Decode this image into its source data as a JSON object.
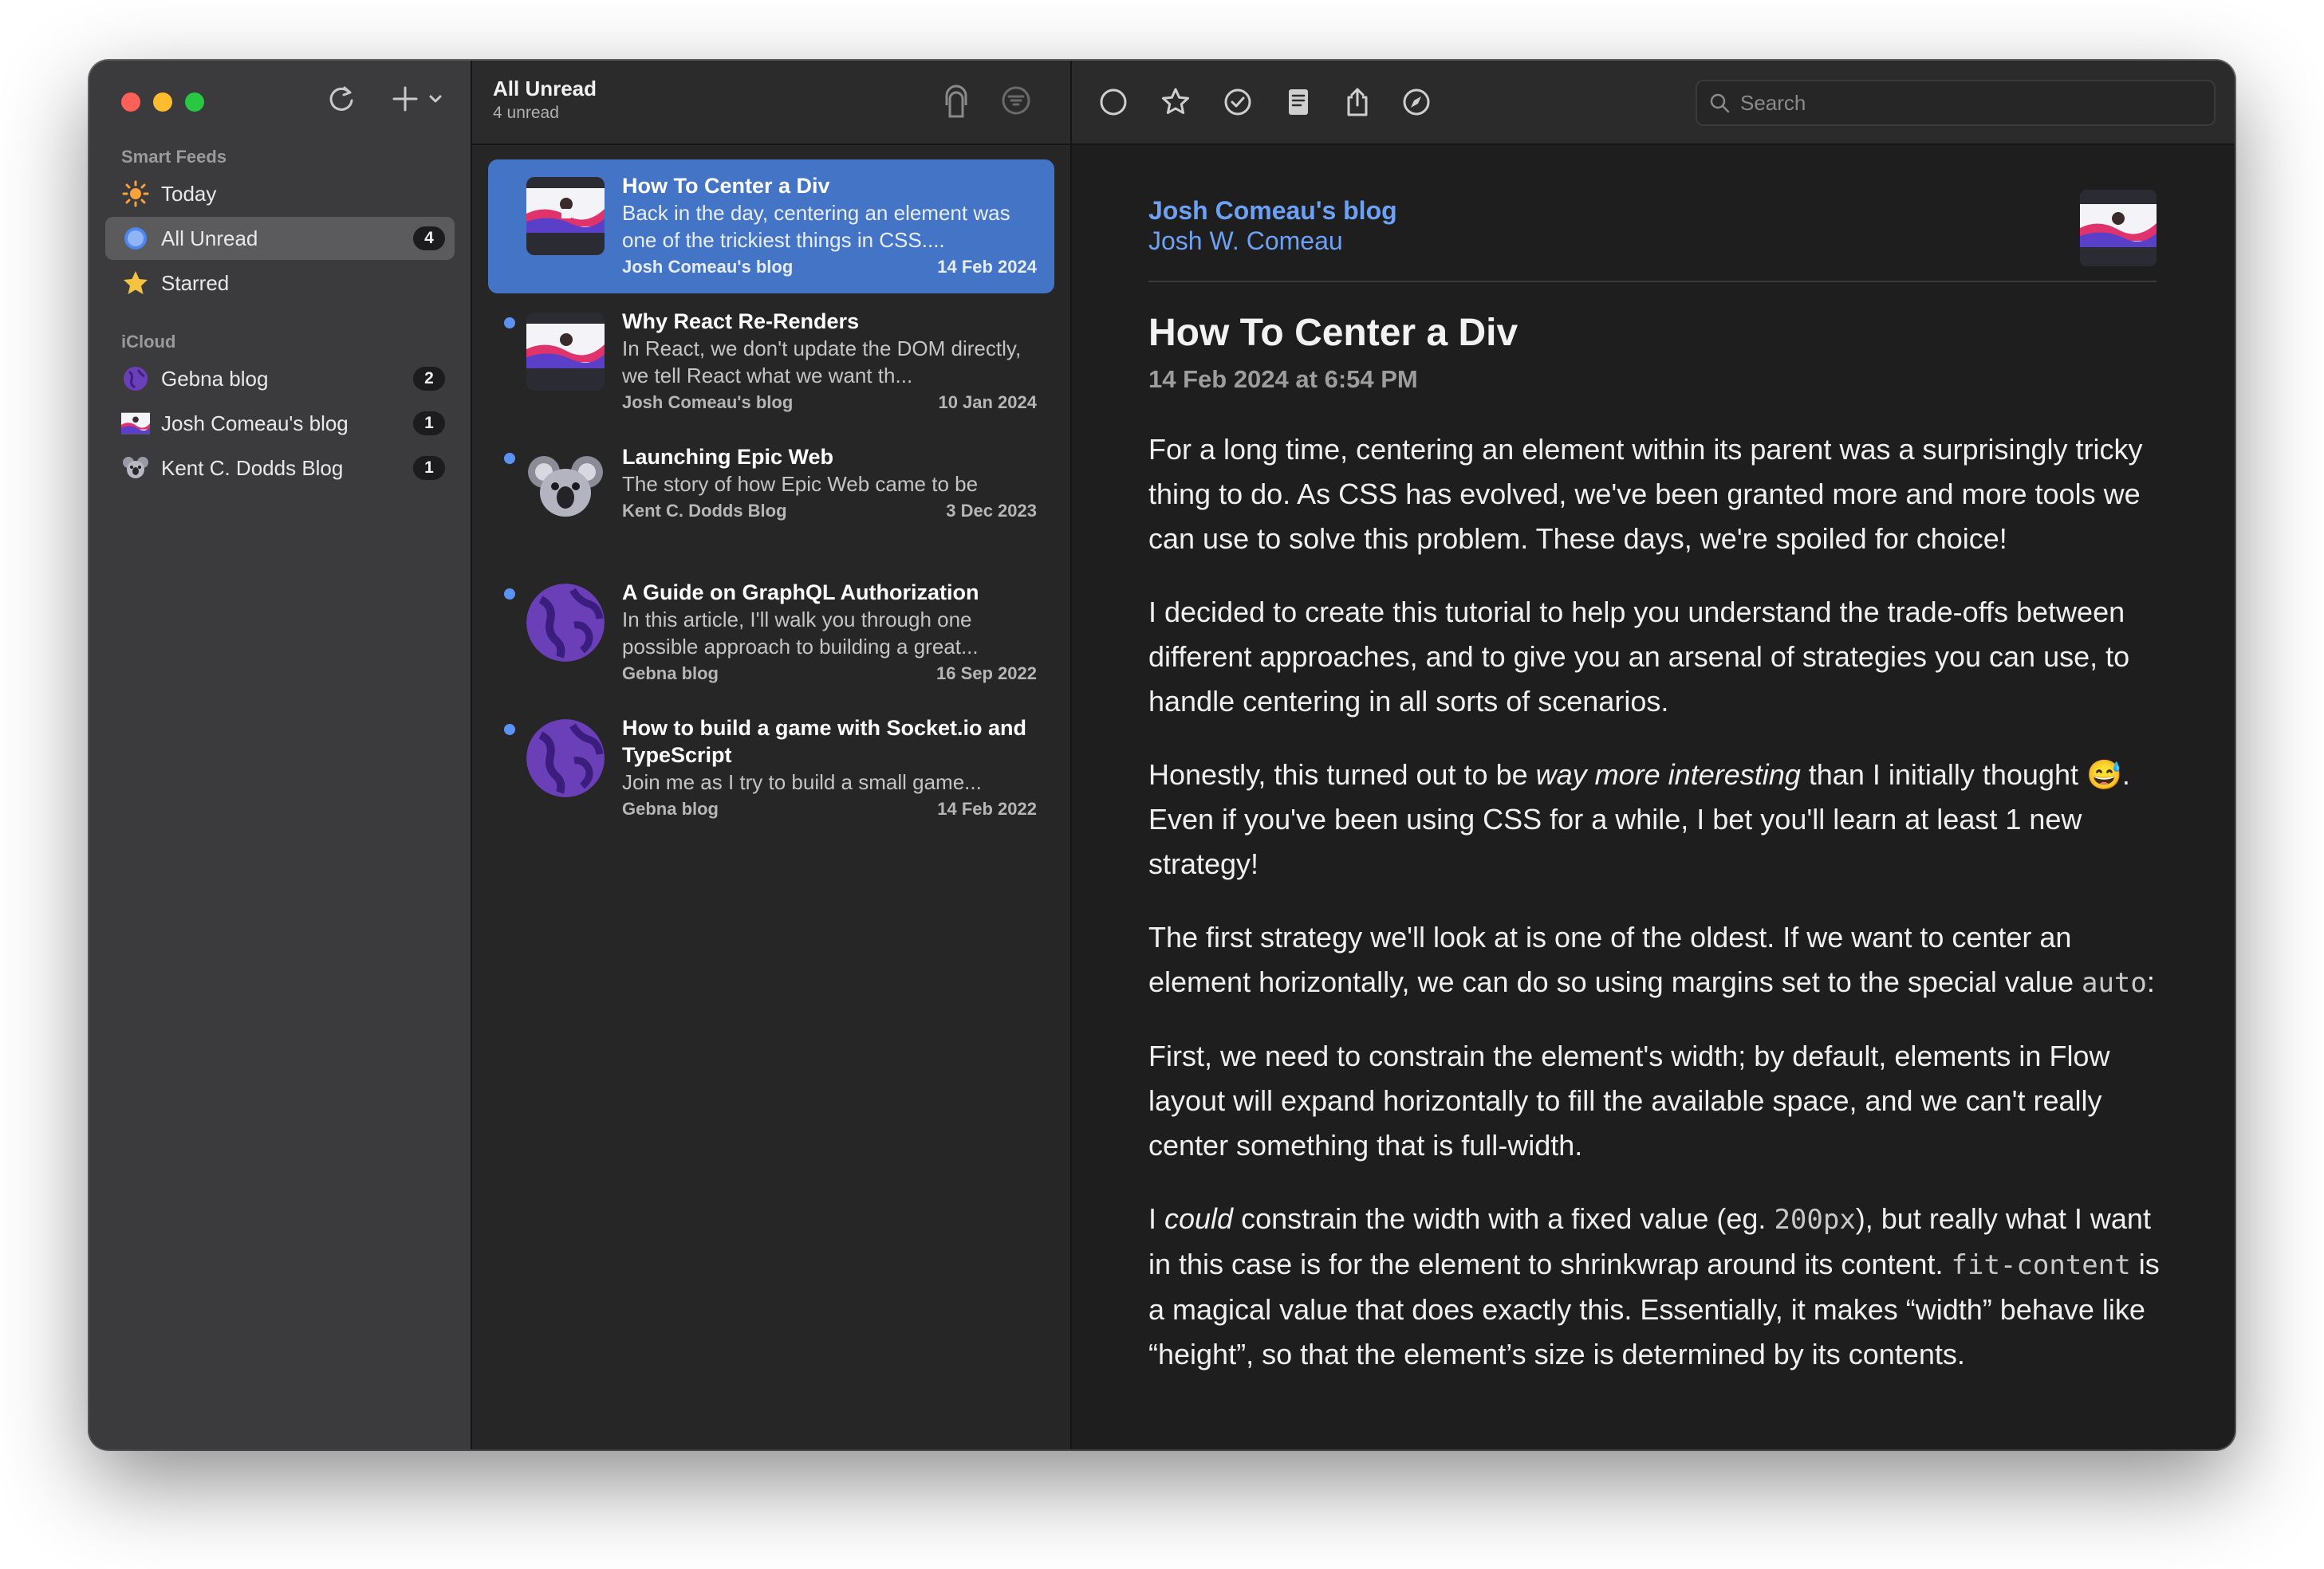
{
  "sidebar": {
    "smart_feeds_label": "Smart Feeds",
    "icloud_label": "iCloud",
    "smart_feeds": [
      {
        "label": "Today",
        "icon": "sun-icon",
        "badge": ""
      },
      {
        "label": "All Unread",
        "icon": "unread-circle-icon",
        "badge": "4"
      },
      {
        "label": "Starred",
        "icon": "star-icon",
        "badge": ""
      }
    ],
    "feeds": [
      {
        "label": "Gebna blog",
        "icon": "gebna-globe-favicon",
        "badge": "2"
      },
      {
        "label": "Josh Comeau's blog",
        "icon": "josh-comeau-favicon",
        "badge": "1"
      },
      {
        "label": "Kent C. Dodds Blog",
        "icon": "koala-favicon",
        "badge": "1"
      }
    ],
    "tools": {
      "refresh": "↻",
      "add": "+",
      "chevron": "⌄"
    }
  },
  "list": {
    "title": "All Unread",
    "subtitle": "4 unread",
    "articles": [
      {
        "title": "How To Center a Div",
        "excerpt": "Back in the day, centering an element was one of the trickiest things in CSS....",
        "feed": "Josh Comeau's blog",
        "date": "14 Feb 2024",
        "selected": true,
        "unread": false
      },
      {
        "title": "Why React Re-Renders",
        "excerpt": "In React, we don't update the DOM directly, we tell React what we want th...",
        "feed": "Josh Comeau's blog",
        "date": "10 Jan 2024",
        "selected": false,
        "unread": true
      },
      {
        "title": "Launching Epic Web",
        "excerpt": "The story of how Epic Web came to be",
        "feed": "Kent C. Dodds Blog",
        "date": "3 Dec 2023",
        "selected": false,
        "unread": true
      },
      {
        "title": "A Guide on GraphQL Authorization",
        "excerpt": "In this article, I'll walk you through one possible approach to building a great...",
        "feed": "Gebna blog",
        "date": "16 Sep 2022",
        "selected": false,
        "unread": true
      },
      {
        "title": "How to build a game with Socket.io and TypeScript",
        "excerpt": "Join me as I try to build a small game...",
        "feed": "Gebna blog",
        "date": "14 Feb 2022",
        "selected": false,
        "unread": true
      }
    ]
  },
  "reader": {
    "search_placeholder": "Search",
    "feed_name": "Josh Comeau's blog",
    "author": "Josh W. Comeau",
    "title": "How To Center a Div",
    "date": "14 Feb 2024 at 6:54 PM",
    "p1": "For a long time, centering an element within its parent was a surprisingly tricky thing to do. As CSS has evolved, we've been granted more and more tools we can use to solve this problem. These days, we're spoiled for choice!",
    "p2": "I decided to create this tutorial to help you understand the trade-offs between different approaches, and to give you an arsenal of strategies you can use, to handle centering in all sorts of scenarios.",
    "p3_a": "Honestly, this turned out to be ",
    "p3_em": "way more interesting",
    "p3_b": " than I initially thought ",
    "p3_emoji": "😅",
    "p3_c": ". Even if you've been using CSS for a while, I bet you'll learn at least 1 new strategy!",
    "p4_a": "The first strategy we'll look at is one of the oldest. If we want to center an element horizontally, we can do so using margins set to the special value ",
    "p4_code": "auto",
    "p4_b": ":",
    "p5": "First, we need to constrain the element's width; by default, elements in Flow layout will expand horizontally to fill the available space, and we can't really center something that is full-width.",
    "p6_a": "I ",
    "p6_em": "could",
    "p6_b": " constrain the width with a fixed value (eg. ",
    "p6_code1": "200px",
    "p6_c": "), but really what I want in this case is for the element to shrinkwrap around its content. ",
    "p6_code2": "fit-content",
    "p6_d": " is a magical value that does exactly this. Essentially, it makes “width” behave like “height”, so that the element’s size is determined by its contents."
  },
  "colors": {
    "accent": "#4474c6",
    "link": "#6da1f5",
    "unread_dot": "#5b93f5"
  }
}
